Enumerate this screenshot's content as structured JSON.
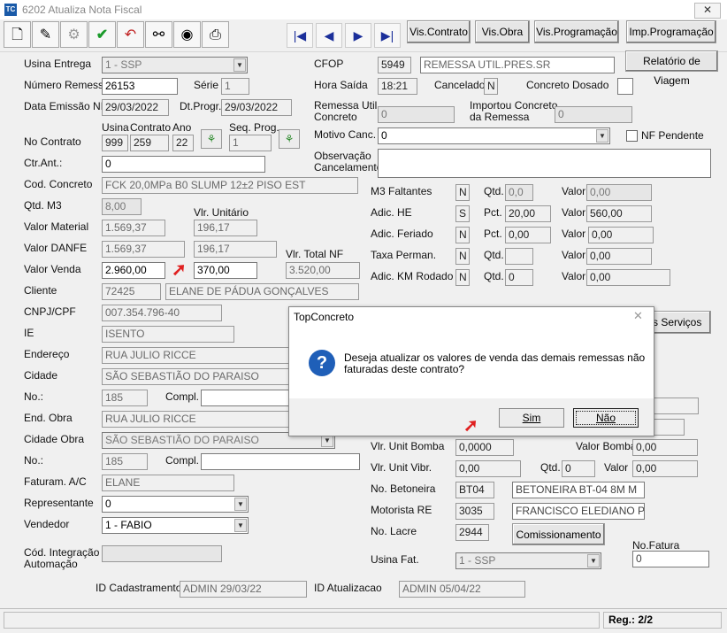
{
  "window": {
    "title": "6202 Atualiza Nota Fiscal",
    "app_icon": "TC",
    "close": "✕"
  },
  "toolbar": {
    "icons": [
      "new-document-icon",
      "edit-pen-icon",
      "settings-icon",
      "save-check-icon",
      "undo-icon",
      "binoculars-search-icon",
      "scanner-icon",
      "printer-icon"
    ],
    "nav": {
      "first": "|◀",
      "prev": "◀",
      "next": "▶",
      "last": "▶|"
    },
    "vis_contrato": "Vis.Contrato",
    "vis_obra": "Vis.Obra",
    "vis_programacao": "Vis.Programação",
    "imp_programacao": "Imp.Programação"
  },
  "left": {
    "usina_entrega": {
      "label": "Usina Entrega",
      "value": "1 - SSP"
    },
    "numero_remessa": {
      "label": "Número Remessa",
      "value": "26153"
    },
    "serie": {
      "label": "Série",
      "value": "1"
    },
    "data_emissao": {
      "label": "Data Emissão NF",
      "value": "29/03/2022"
    },
    "dt_prog": {
      "label": "Dt.Progr.",
      "value": "29/03/2022"
    },
    "contrato_headers": {
      "usina": "Usina",
      "contrato": "Contrato",
      "ano": "Ano",
      "seq_prog": "Seq. Prog."
    },
    "no_contrato": {
      "label": "No Contrato",
      "usina": "999",
      "contrato": "259",
      "ano": "22",
      "seq": "1"
    },
    "ctr_ant": {
      "label": "Ctr.Ant.:",
      "value": "0"
    },
    "cod_concreto": {
      "label": "Cod. Concreto",
      "value": "FCK 20,0MPa B0 SLUMP 12±2 PISO EST"
    },
    "qtd_m3": {
      "label": "Qtd. M3",
      "value": "8,00"
    },
    "vlr_unitario_label": "Vlr. Unitário",
    "valor_material": {
      "label": "Valor Material",
      "value": "1.569,37",
      "unit": "196,17"
    },
    "valor_danfe": {
      "label": "Valor DANFE",
      "value": "1.569,37",
      "unit": "196,17"
    },
    "vlr_total_nf_label": "Vlr. Total NF",
    "valor_venda": {
      "label": "Valor Venda",
      "value": "2.960,00",
      "unit": "370,00",
      "total_nf": "3.520,00"
    },
    "cliente": {
      "label": "Cliente",
      "code": "72425",
      "name": "ELANE DE PÁDUA GONÇALVES"
    },
    "cnpj": {
      "label": "CNPJ/CPF",
      "value": "007.354.796-40"
    },
    "ie": {
      "label": "IE",
      "value": "ISENTO"
    },
    "endereco": {
      "label": "Endereço",
      "value": "RUA JULIO RICCE"
    },
    "cidade": {
      "label": "Cidade",
      "value": "SÃO SEBASTIÃO DO PARAISO"
    },
    "no1": {
      "label": "No.:",
      "value": "185",
      "compl_label": "Compl.",
      "compl": ""
    },
    "end_obra": {
      "label": "End. Obra",
      "value": "RUA JULIO RICCE"
    },
    "cidade_obra": {
      "label": "Cidade Obra",
      "value": "SÃO SEBASTIÃO DO PARAISO"
    },
    "no2": {
      "label": "No.:",
      "value": "185",
      "compl_label": "Compl.",
      "compl": ""
    },
    "faturam": {
      "label": "Faturam. A/C",
      "value": "ELANE"
    },
    "representante": {
      "label": "Representante",
      "value": "0"
    },
    "vendedor": {
      "label": "Vendedor",
      "value": "1 - FABIO"
    },
    "cod_integracao": {
      "label1": "Cód. Integração",
      "label2": "Automação",
      "value": ""
    },
    "id_cadastramento": {
      "label": "ID Cadastramento",
      "value": "ADMIN 29/03/22"
    },
    "id_atualizacao": {
      "label": "ID Atualizacao",
      "value": "ADMIN 05/04/22"
    }
  },
  "right": {
    "relatorio_viagem": "Relatório de Viagem",
    "cfop": {
      "label": "CFOP",
      "code": "5949",
      "desc": "REMESSA UTIL.PRES.SR"
    },
    "hora_saida": {
      "label": "Hora Saída",
      "value": "18:21"
    },
    "cancelado": {
      "label": "Cancelado",
      "value": "N"
    },
    "concreto_dosado": {
      "label": "Concreto Dosado",
      "value": ""
    },
    "remessa_util": {
      "label1": "Remessa Util.",
      "label2": "Concreto",
      "value": "0"
    },
    "importou": {
      "label1": "Importou Concreto",
      "label2": "da Remessa",
      "value": "0"
    },
    "motivo_canc": {
      "label": "Motivo Canc.",
      "value": "0"
    },
    "nf_pendente": {
      "label": "NF Pendente"
    },
    "observacao": {
      "label1": "Observação",
      "label2": "Cancelamento",
      "value": ""
    },
    "m3_faltantes": {
      "label": "M3 Faltantes",
      "flag": "N",
      "sub_label": "Qtd.",
      "sub": "0,0",
      "valor_label": "Valor",
      "valor": "0,00"
    },
    "adic_he": {
      "label": "Adic. HE",
      "flag": "S",
      "sub_label": "Pct.",
      "sub": "20,00",
      "valor_label": "Valor",
      "valor": "560,00"
    },
    "adic_feriado": {
      "label": "Adic. Feriado",
      "flag": "N",
      "sub_label": "Pct.",
      "sub": "0,00",
      "valor_label": "Valor",
      "valor": "0,00"
    },
    "taxa_perman": {
      "label": "Taxa Perman.",
      "flag": "N",
      "sub_label": "Qtd.",
      "sub": "",
      "valor_label": "Valor",
      "valor": "0,00"
    },
    "adic_km": {
      "label": "Adic. KM Rodado",
      "flag": "N",
      "sub_label": "Qtd.",
      "sub": "0",
      "valor_label": "Valor",
      "valor": "0,00"
    },
    "demais_servicos": "ais Serviços",
    "vlr_unit_bomba": {
      "label": "Vlr. Unit Bomba",
      "value": "0,0000",
      "valor_label": "Valor Bomba",
      "valor": "0,00"
    },
    "vlr_unit_vibr": {
      "label": "Vlr. Unit Vibr.",
      "value": "0,00",
      "qtd_label": "Qtd.",
      "qtd": "0",
      "valor_label": "Valor",
      "valor": "0,00"
    },
    "betoneira": {
      "label": "No. Betoneira",
      "code": "BT04",
      "desc": "BETONEIRA BT-04 8M M"
    },
    "motorista": {
      "label": "Motorista  RE",
      "code": "3035",
      "name": "FRANCISCO ELEDIANO P"
    },
    "lacre": {
      "label": "No. Lacre",
      "value": "2944"
    },
    "comissionamento": "Comissionamento",
    "no_fatura": {
      "label": "No.Fatura",
      "value": "0"
    },
    "usina_fat": {
      "label": "Usina Fat.",
      "value": "1 - SSP"
    }
  },
  "dialog": {
    "title": "TopConcreto",
    "message_line1": "Deseja atualizar os valores de venda das demais remessas não",
    "message_line2": "faturadas deste contrato?",
    "yes": "Sim",
    "no": "Não",
    "close": "✕",
    "icon": "?"
  },
  "status": {
    "reg": "Reg.: 2/2"
  },
  "annotation": {
    "arrow_glyph": "➚",
    "arrow_color": "#e02020"
  }
}
